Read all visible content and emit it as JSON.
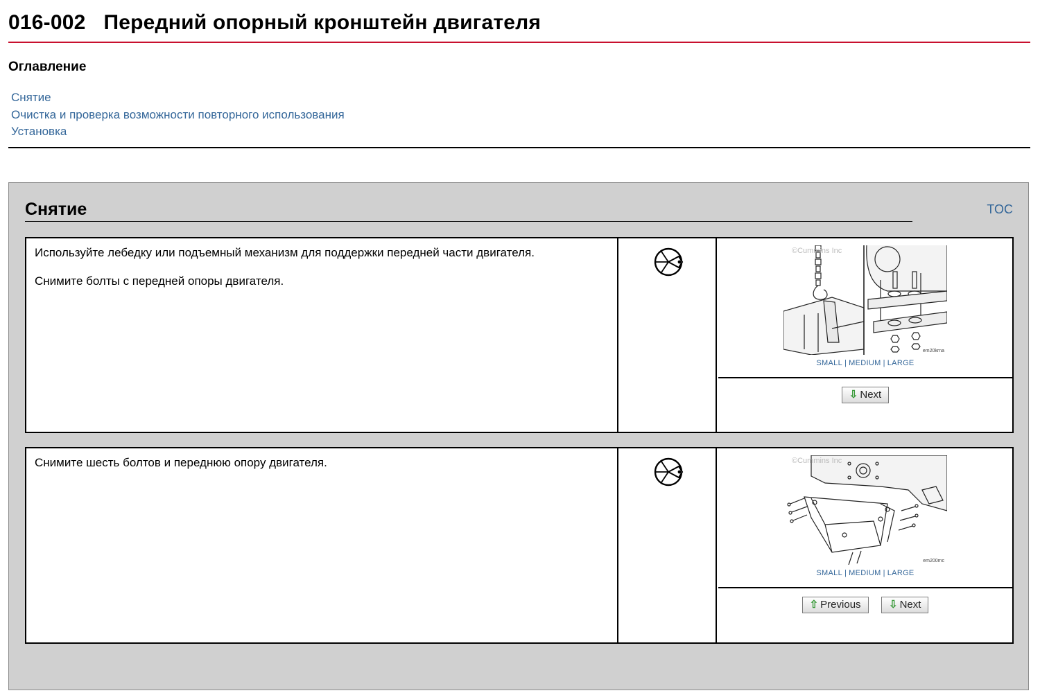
{
  "document": {
    "code": "016-002",
    "title": "Передний опорный кронштейн двигателя"
  },
  "toc": {
    "heading": "Оглавление",
    "items": [
      {
        "label": "Снятие"
      },
      {
        "label": "Очистка и проверка возможности повторного использования"
      },
      {
        "label": "Установка"
      }
    ]
  },
  "section": {
    "title": "Снятие",
    "toc_link": "TOC",
    "steps": [
      {
        "paragraphs": [
          "Используйте лебедку или подъемный механизм для поддержки передней части двигателя.",
          "Снимите болты с передней опоры двигателя."
        ],
        "icon": "wrench-tool-icon",
        "watermark": "©Cummins Inc",
        "figure_code": "em20krna",
        "sizes": [
          "SMALL",
          "MEDIUM",
          "LARGE"
        ],
        "buttons": [
          {
            "label": "Next",
            "arrow": "⇩"
          }
        ]
      },
      {
        "paragraphs": [
          "Снимите шесть болтов и переднюю опору двигателя."
        ],
        "icon": "wrench-tool-icon",
        "watermark": "©Cummins Inc",
        "figure_code": "em200mc",
        "sizes": [
          "SMALL",
          "MEDIUM",
          "LARGE"
        ],
        "buttons": [
          {
            "label": "Previous",
            "arrow": "⇧"
          },
          {
            "label": "Next",
            "arrow": "⇩"
          }
        ]
      }
    ]
  },
  "colors": {
    "title_rule": "#c8102e",
    "link": "#336699",
    "section_bg": "#d0d0d0"
  }
}
